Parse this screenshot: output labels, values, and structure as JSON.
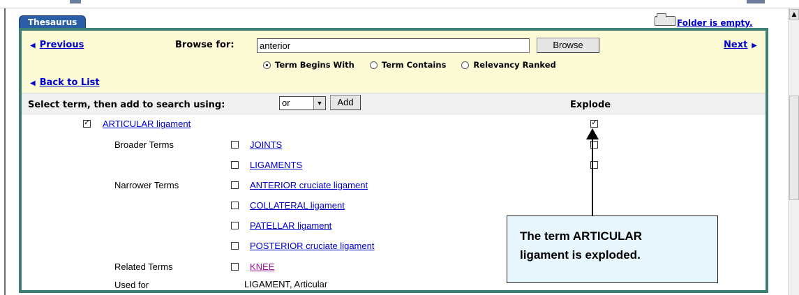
{
  "tab": {
    "label": "Thesaurus"
  },
  "folder": {
    "status": "Folder is empty."
  },
  "nav": {
    "previous": "Previous",
    "next": "Next",
    "back_to_list": "Back to List"
  },
  "browse": {
    "label": "Browse for:",
    "value": "anterior",
    "button": "Browse",
    "options": [
      {
        "label": "Term Begins With",
        "selected": true
      },
      {
        "label": "Term Contains",
        "selected": false
      },
      {
        "label": "Relevancy Ranked",
        "selected": false
      }
    ]
  },
  "select_bar": {
    "label": "Select term, then add to search using:",
    "operator": "or",
    "add_button": "Add",
    "explode_header": "Explode"
  },
  "main_term": {
    "label": "ARTICULAR ligament",
    "checked": true,
    "explode_checked": true
  },
  "groups": {
    "broader": "Broader Terms",
    "narrower": "Narrower Terms",
    "related": "Related Terms",
    "used_for": "Used for"
  },
  "broader_terms": [
    "JOINTS",
    "LIGAMENTS"
  ],
  "narrower_terms": [
    "ANTERIOR cruciate ligament",
    "COLLATERAL ligament",
    "PATELLAR ligament",
    "POSTERIOR cruciate ligament"
  ],
  "related_terms": [
    "KNEE"
  ],
  "used_for_value": "LIGAMENT, Articular",
  "callout": {
    "text": "The term  ARTICULAR\nligament is exploded."
  },
  "colors": {
    "frame": "#3c7f74",
    "browse_bg": "#fdfbd5",
    "tab_bg": "#2a5fa8",
    "link": "#0000cc",
    "visited_link": "#a0129e",
    "callout_bg": "#e8f6fd"
  }
}
